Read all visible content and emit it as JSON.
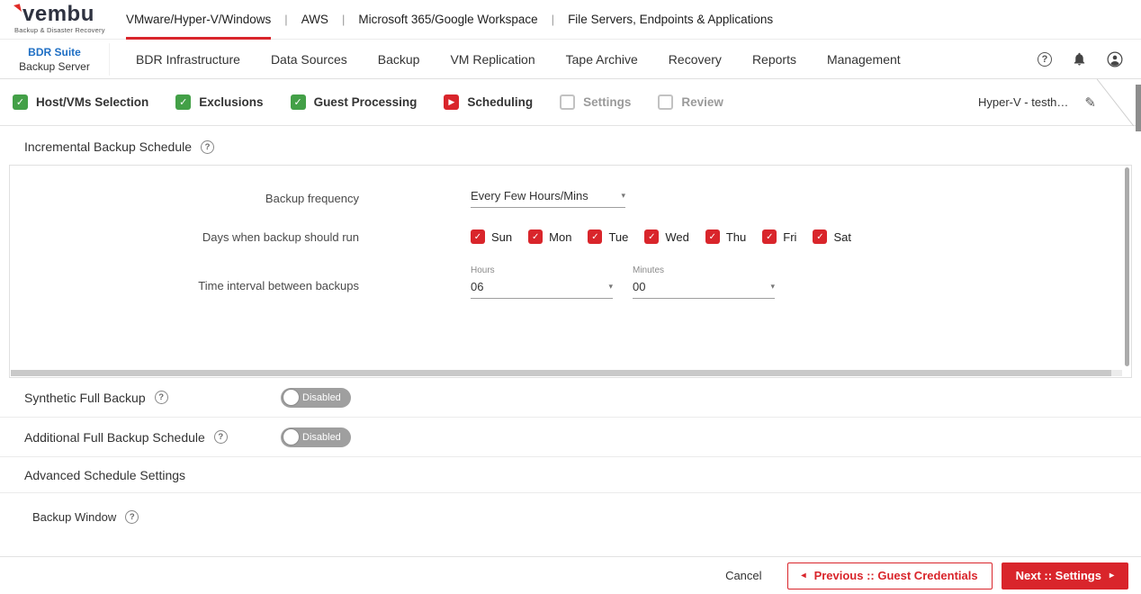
{
  "icons": {
    "help": "?",
    "caret": "▾",
    "check": "✓",
    "play": "▶",
    "prev_chevron": "◂",
    "next_chevron": "▸",
    "edit": "✎",
    "separator": "|"
  },
  "brand": {
    "logo": "vembu",
    "tagline": "Backup & Disaster Recovery"
  },
  "top_nav": {
    "items": [
      {
        "label": "VMware/Hyper-V/Windows",
        "active": true
      },
      {
        "label": "AWS",
        "active": false
      },
      {
        "label": "Microsoft 365/Google Workspace",
        "active": false
      },
      {
        "label": "File Servers, Endpoints & Applications",
        "active": false
      }
    ]
  },
  "app_bar": {
    "product": "BDR Suite",
    "product_sub": "Backup Server",
    "menu": [
      "BDR Infrastructure",
      "Data Sources",
      "Backup",
      "VM Replication",
      "Tape Archive",
      "Recovery",
      "Reports",
      "Management"
    ]
  },
  "wizard": {
    "steps": [
      {
        "label": "Host/VMs Selection",
        "state": "done"
      },
      {
        "label": "Exclusions",
        "state": "done"
      },
      {
        "label": "Guest Processing",
        "state": "done"
      },
      {
        "label": "Scheduling",
        "state": "current"
      },
      {
        "label": "Settings",
        "state": "pending"
      },
      {
        "label": "Review",
        "state": "pending"
      }
    ],
    "job_name": "Hyper-V - testh…"
  },
  "schedule": {
    "section_title": "Incremental Backup Schedule",
    "frequency_label": "Backup frequency",
    "frequency_value": "Every Few Hours/Mins",
    "days_label": "Days when backup should run",
    "days": [
      {
        "label": "Sun",
        "checked": true
      },
      {
        "label": "Mon",
        "checked": true
      },
      {
        "label": "Tue",
        "checked": true
      },
      {
        "label": "Wed",
        "checked": true
      },
      {
        "label": "Thu",
        "checked": true
      },
      {
        "label": "Fri",
        "checked": true
      },
      {
        "label": "Sat",
        "checked": true
      }
    ],
    "interval_label": "Time interval between backups",
    "hours_label": "Hours",
    "hours_value": "06",
    "minutes_label": "Minutes",
    "minutes_value": "00"
  },
  "sections": {
    "synthetic_full": {
      "label": "Synthetic Full Backup",
      "toggle": "Disabled"
    },
    "additional_full": {
      "label": "Additional Full Backup Schedule",
      "toggle": "Disabled"
    },
    "advanced": {
      "label": "Advanced Schedule Settings"
    },
    "backup_window": {
      "label": "Backup Window"
    }
  },
  "footer": {
    "cancel": "Cancel",
    "previous": "Previous :: Guest Credentials",
    "next": "Next :: Settings"
  }
}
